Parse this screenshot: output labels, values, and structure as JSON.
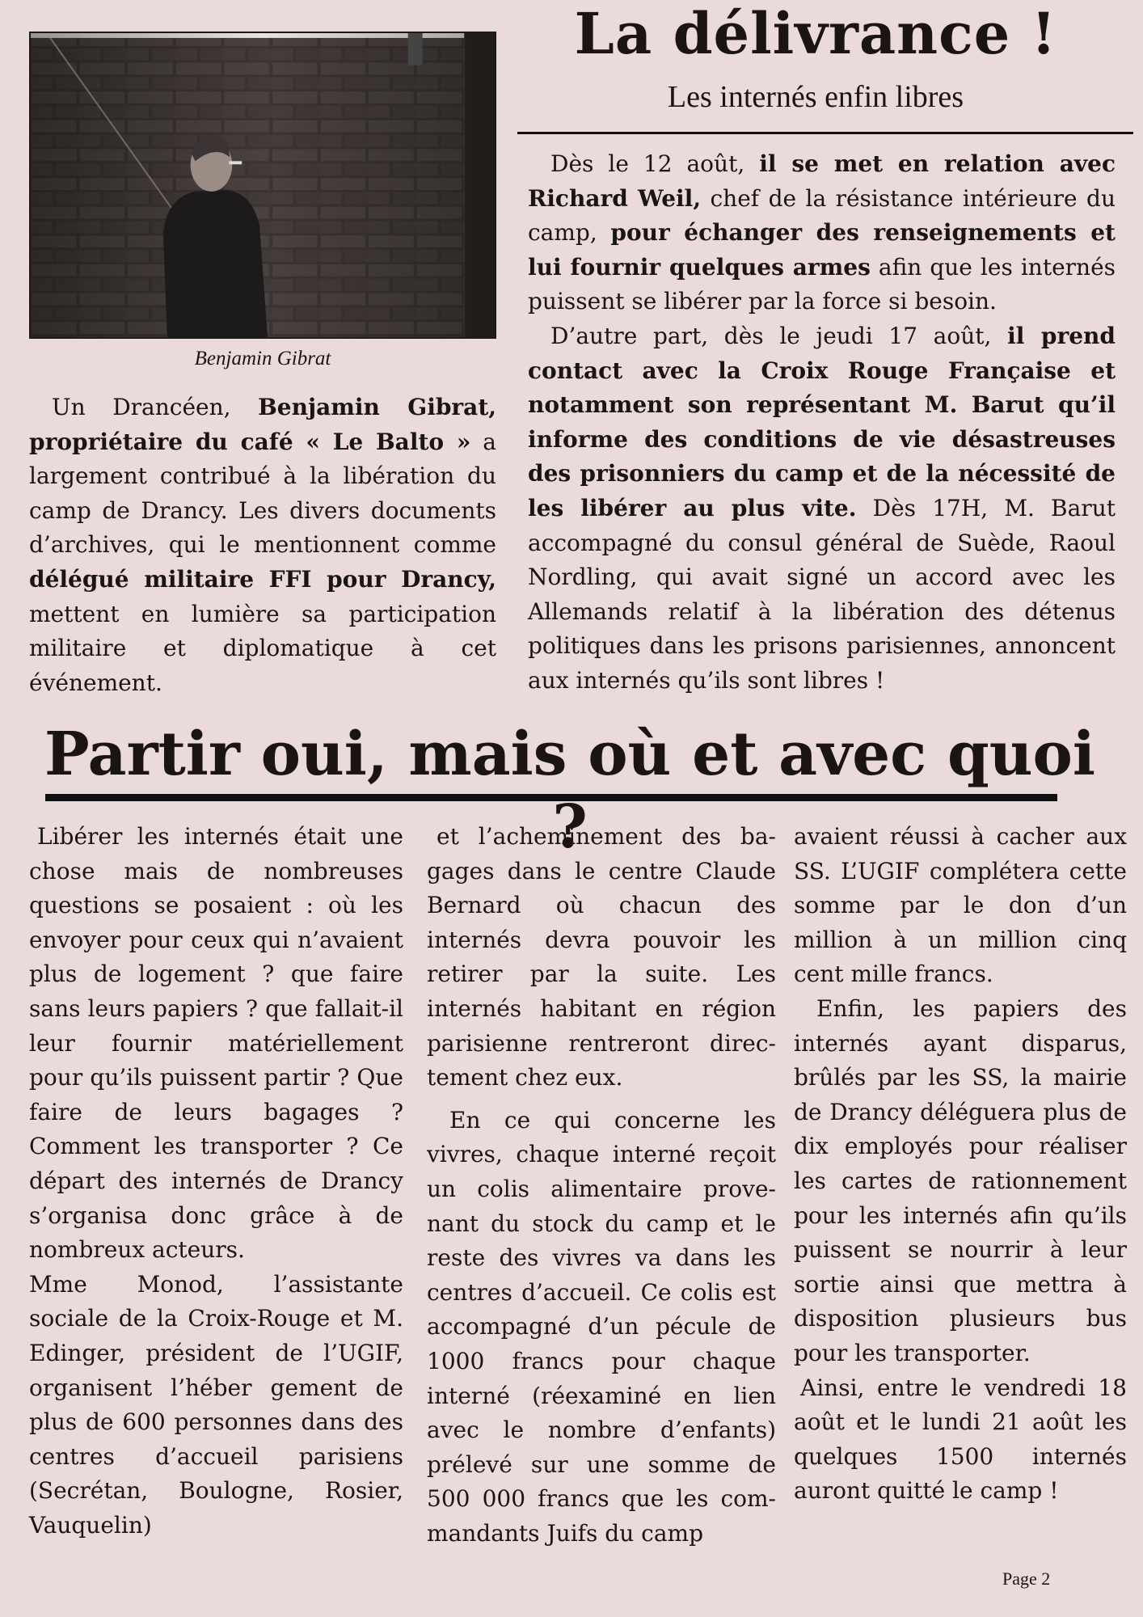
{
  "photo": {
    "alt": "Benjamin Gibrat",
    "caption": "Benjamin Gibrat"
  },
  "headline1": {
    "title": "La délivrance !",
    "subtitle": "Les internés enfin libres"
  },
  "intro": {
    "p1_a": "Un Drancéen, ",
    "p1_b": "Benjamin Gibrat, propriétaire du café « Le Balto »",
    "p1_c": " a largement contribué à la libération du camp de Drancy. Les divers documents d’archives, qui le mentionnent comme ",
    "p1_d": "délégué militaire FFI pour Drancy,",
    "p1_e": " mettent en lumière sa participation militaire et diplomatique à cet événement."
  },
  "right": {
    "p1_a": "Dès le 12 août, ",
    "p1_b": "il se met en relation avec Richard Weil,",
    "p1_c": " chef de la résistance intérieure du camp, ",
    "p1_d": "pour échanger des renseignements et lui fournir quelques armes",
    "p1_e": " afin que les internés puissent se libérer par la force si besoin.",
    "p2_a": "D’autre part, dès le jeudi 17 août, ",
    "p2_b": "il prend contact avec la Croix Rouge Française et notamment son représentant M. Barut qu’il informe des conditions de vie désastreuses des prisonniers du camp et de la nécessité de les libérer au plus vite.",
    "p2_c": " Dès 17H, M. Barut accompagné du consul général de Suède, Raoul Nordling, qui avait signé un accord avec les Allemands relatif à la libération des détenus politiques dans les prisons parisiennes, annoncent aux internés qu’ils sont libres !"
  },
  "headline2": {
    "title": "Partir oui, mais où et avec quoi ?"
  },
  "col1": {
    "p1": "Libérer les internés était une chose mais de nombreuses questions se posaient : où les envoyer pour ceux qui n’avaient plus de logement ? que faire sans leurs papiers ? que fallait-il leur fournir matériellement pour qu’ils puissent partir ? Que faire de leurs bagages ? Comment les transporter ? Ce départ des internés de Drancy s’organisa donc grâce à de nombreux acteurs.",
    "p2": "Mme Monod, l’assistante sociale de la Croix-Rouge et M. Edinger, président de l’UGIF, organisent l’héber gement de plus de 600 personnes dans des centres d’accueil parisiens (Secrétan, Boulogne, Rosier, Vauquelin)"
  },
  "col2": {
    "p1": "et l’acheminement des ba-gages dans le centre Claude Bernard où chacun des internés devra pouvoir les retirer par la suite. Les internés habitant en région parisienne rentreront direc-tement chez eux.",
    "p2": "En ce qui concerne les vivres, chaque interné reçoit un colis alimentaire prove-nant du stock du camp et le reste des vivres va dans les centres d’accueil. Ce colis est accompagné d’un pécule de 1000 francs pour chaque interné (réexaminé en lien avec le nombre d’enfants) prélevé sur une somme de 500 000 francs que les com-mandants Juifs du camp"
  },
  "col3": {
    "p1": "avaient réussi à cacher aux SS. L’UGIF complétera cette somme par le don d’un million à un million cinq cent mille francs.",
    "p2": "Enfin, les papiers des internés ayant disparus, brûlés par les SS, la mairie de Drancy déléguera plus de dix employés pour réaliser les cartes de rationnement pour les internés afin qu’ils puissent se nourrir à leur sortie ainsi que mettra à disposition plusieurs bus pour les transporter.",
    "p3": "Ainsi, entre le vendredi 18 août et le lundi 21 août les quelques 1500 internés auront quitté le camp !"
  },
  "footer": {
    "page": "Page 2"
  }
}
